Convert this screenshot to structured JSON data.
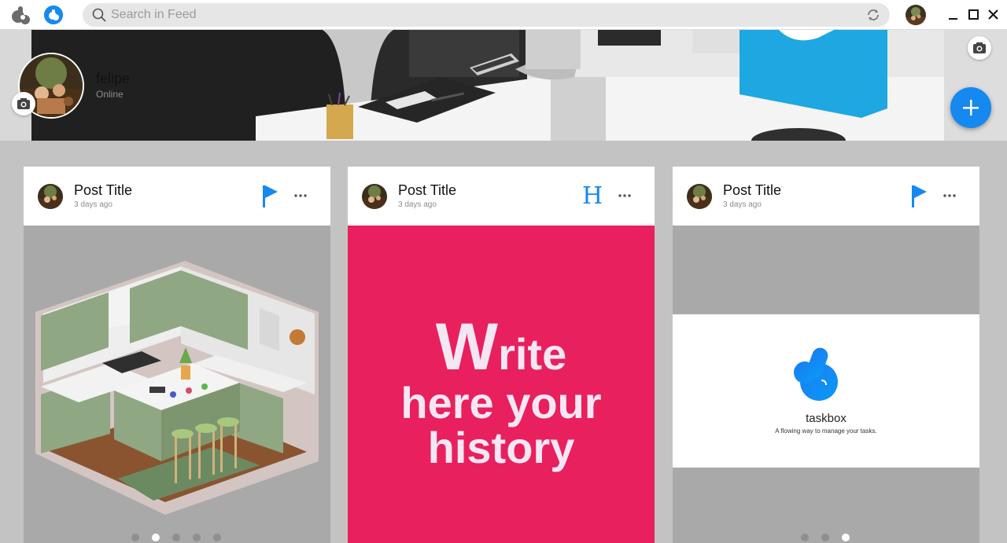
{
  "search": {
    "placeholder": "Search in Feed"
  },
  "profile": {
    "name": "felipe",
    "status": "Online"
  },
  "posts": [
    {
      "title": "Post Title",
      "time": "3 days ago"
    },
    {
      "title": "Post Title",
      "time": "3 days ago",
      "badge": "H",
      "story": {
        "first_letter": "W",
        "line1_rest": "rite",
        "line2": "here your",
        "line3": "history"
      }
    },
    {
      "title": "Post Title",
      "time": "3 days ago",
      "app": {
        "name": "taskbox",
        "tagline": "A flowing way to manage your tasks."
      }
    }
  ],
  "colors": {
    "accent": "#1589f0",
    "story_background": "#e8205e",
    "page_background": "#c3c3c3"
  },
  "icons": [
    "app-logo-icon",
    "notification-badge-icon",
    "search-icon",
    "sync-icon",
    "minimize-icon",
    "maximize-icon",
    "close-icon",
    "camera-icon",
    "plus-icon",
    "flag-icon",
    "more-icon"
  ],
  "carousels": [
    {
      "count": 5,
      "active": 2
    },
    {
      "count": 3,
      "active": 3
    }
  ]
}
